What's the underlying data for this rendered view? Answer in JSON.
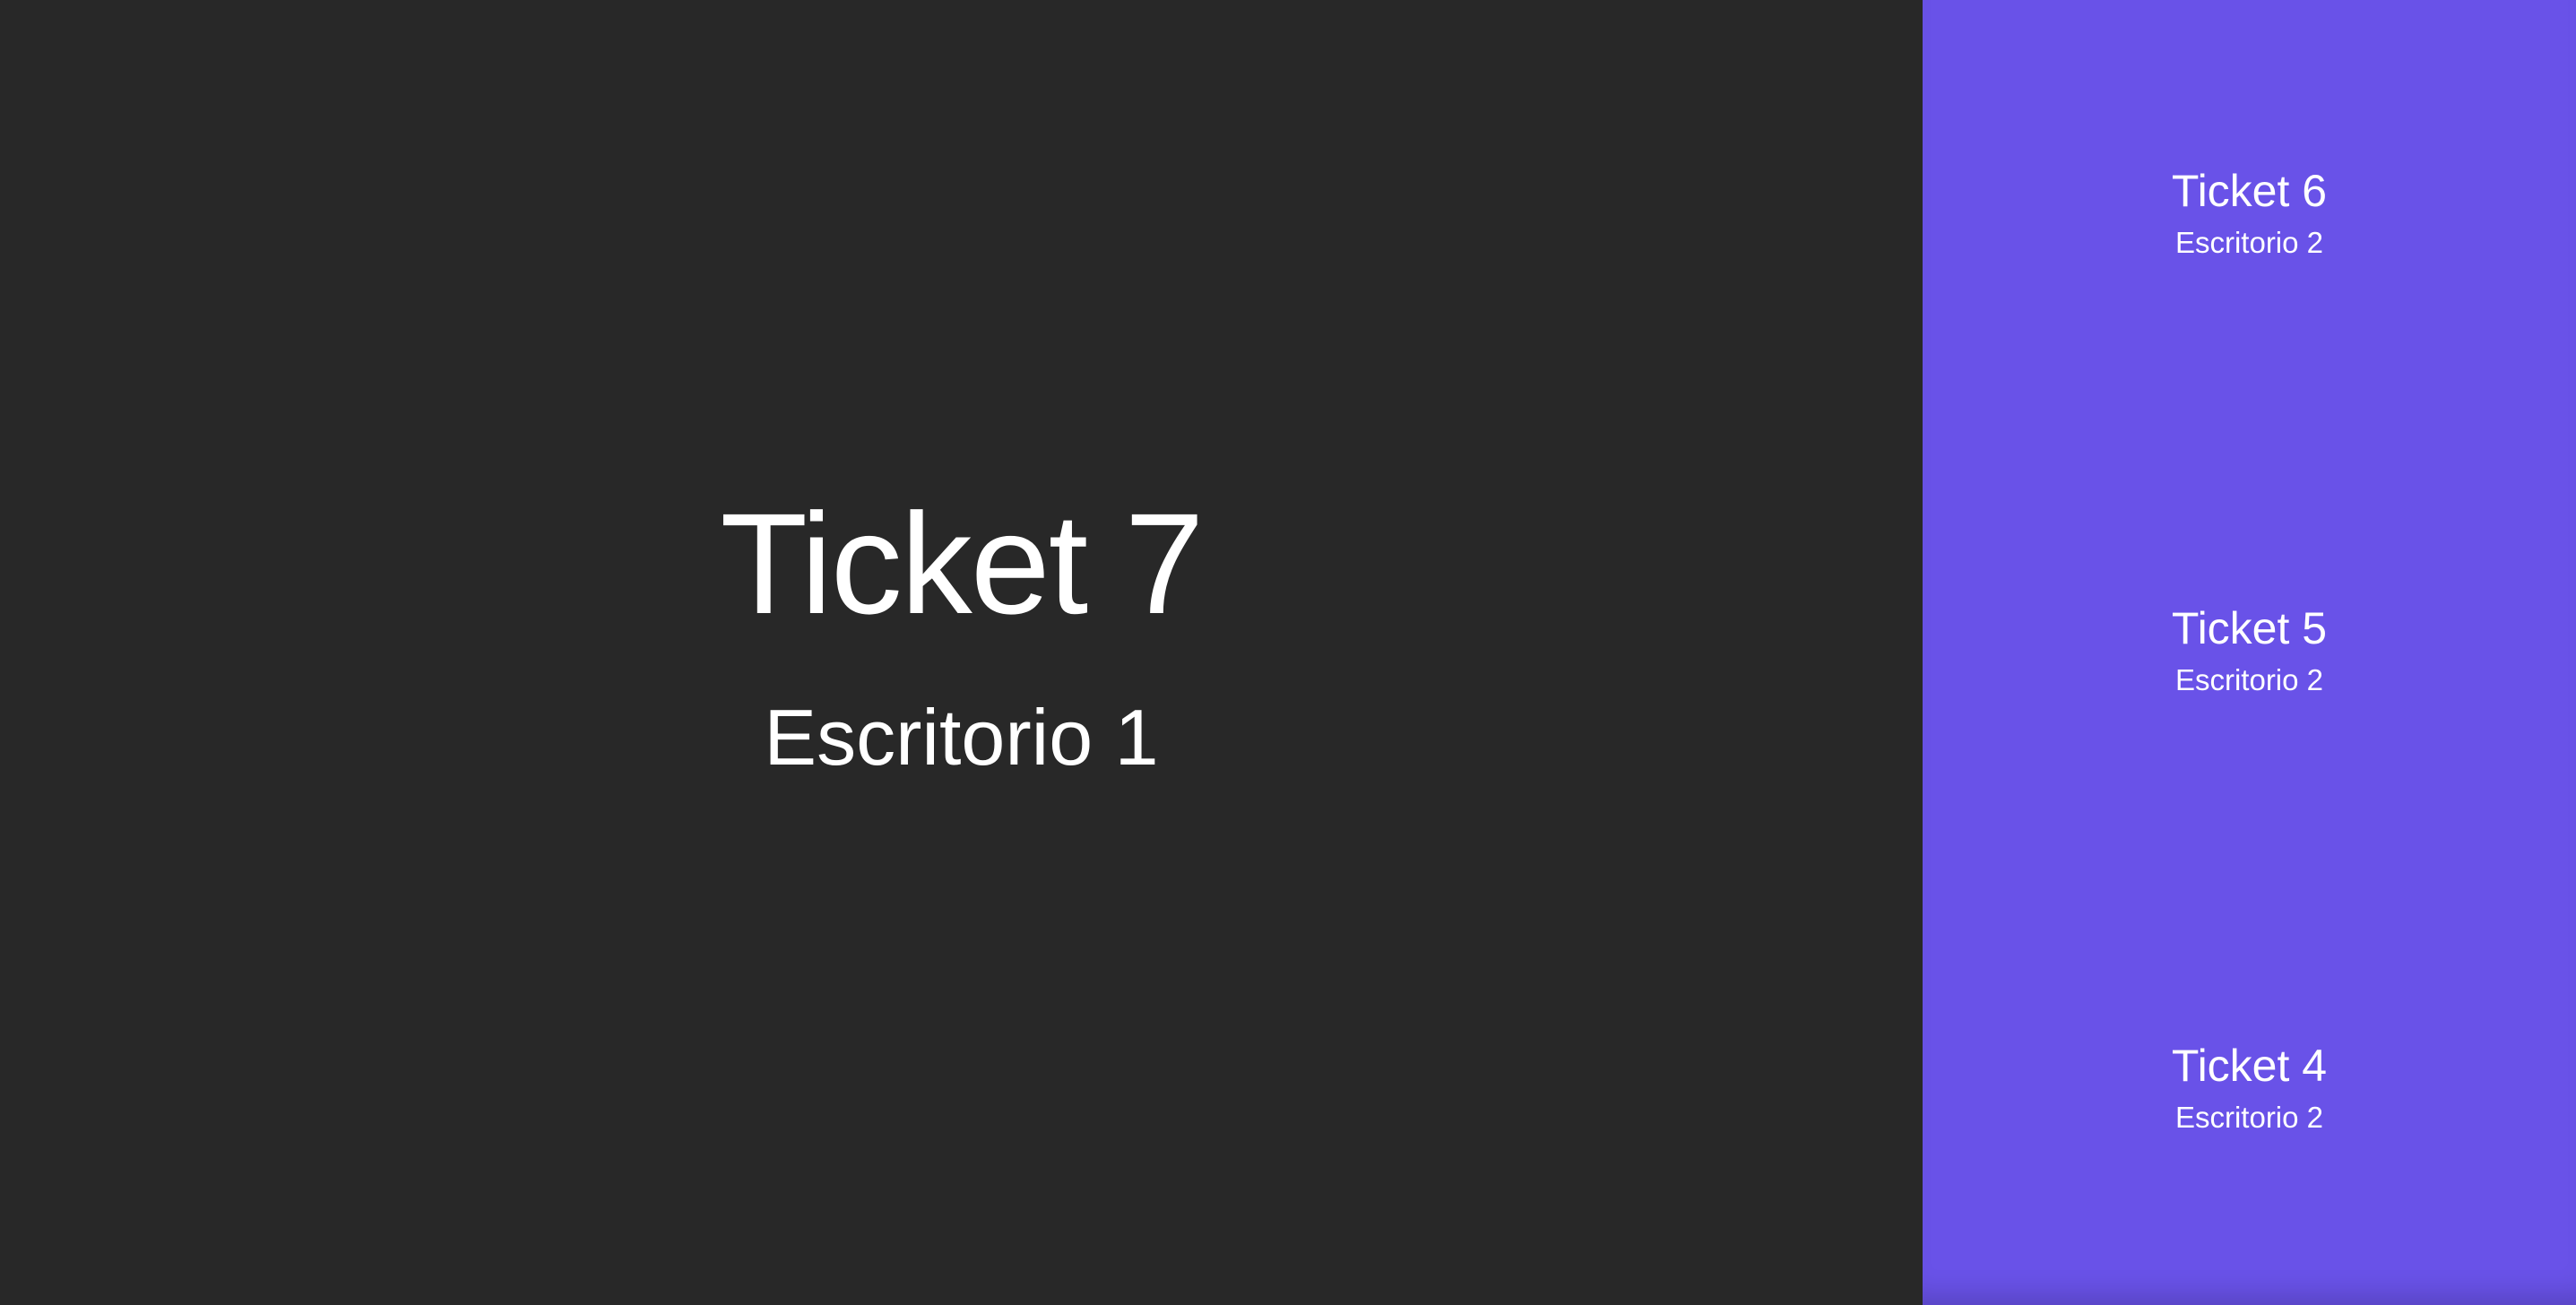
{
  "current": {
    "ticket": "Ticket 7",
    "desk": "Escritorio 1"
  },
  "history": [
    {
      "ticket": "Ticket 6",
      "desk": "Escritorio 2"
    },
    {
      "ticket": "Ticket 5",
      "desk": "Escritorio 2"
    },
    {
      "ticket": "Ticket 4",
      "desk": "Escritorio 2"
    }
  ],
  "colors": {
    "main_background": "#282828",
    "side_background": "#6952e8",
    "text": "#ffffff"
  }
}
